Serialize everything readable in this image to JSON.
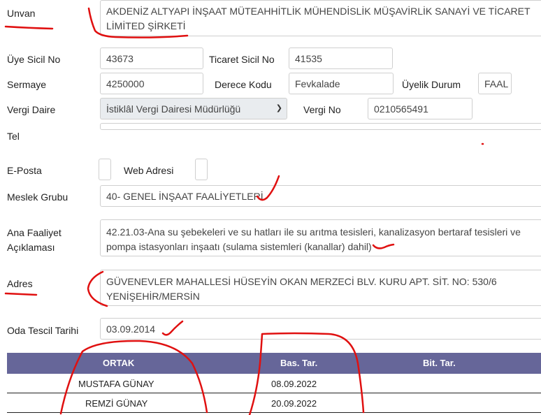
{
  "labels": {
    "unvan": "Unvan",
    "uye_sicil_no": "Üye Sicil No",
    "ticaret_sicil_no": "Ticaret Sicil No",
    "sermaye": "Sermaye",
    "derece_kodu": "Derece Kodu",
    "uyelik_durum": "Üyelik Durum",
    "vergi_daire": "Vergi Daire",
    "vergi_no": "Vergi No",
    "tel": "Tel",
    "e_posta": "E-Posta",
    "web_adresi": "Web Adresi",
    "meslek_grubu": "Meslek Grubu",
    "ana_faaliyet_line1": "Ana Faaliyet",
    "ana_faaliyet_line2": "Açıklaması",
    "adres": "Adres",
    "oda_tescil_tarihi": "Oda Tescil Tarihi"
  },
  "values": {
    "unvan": "AKDENİZ ALTYAPI İNŞAAT MÜTEAHHİTLİK MÜHENDİSLİK MÜŞAVİRLİK SANAYİ VE TİCARET LİMİTED ŞİRKETİ",
    "uye_sicil_no": "43673",
    "ticaret_sicil_no": "41535",
    "sermaye": "4250000",
    "derece_kodu": "Fevkalade",
    "uyelik_durum": "FAAL",
    "vergi_daire": "İstiklâl Vergi Dairesi Müdürlüğü",
    "vergi_no": "0210565491",
    "tel": "",
    "e_posta": "",
    "web_adresi": "",
    "meslek_grubu": "40- GENEL İNŞAAT FAALİYETLERİ",
    "ana_faaliyet": "42.21.03-Ana su şebekeleri ve su hatları ile su arıtma tesisleri, kanalizasyon bertaraf tesisleri ve pompa istasyonları inşaatı (sulama sistemleri (kanallar) dahil)",
    "adres": "GÜVENEVLER MAHALLESİ HÜSEYİN OKAN MERZECİ BLV. KURU APT. SİT. NO: 530/6 YENİŞEHİR/MERSİN",
    "oda_tescil_tarihi": "03.09.2014"
  },
  "table": {
    "headers": [
      "ORTAK",
      "Bas. Tar.",
      "Bit. Tar."
    ],
    "rows": [
      [
        "MUSTAFA  GÜNAY",
        "08.09.2022",
        ""
      ],
      [
        "REMZİ  GÜNAY",
        "20.09.2022",
        ""
      ]
    ]
  },
  "colors": {
    "table_header": "#666699",
    "annotation_ink": "#e01010",
    "select_bg": "#e9ecef"
  }
}
